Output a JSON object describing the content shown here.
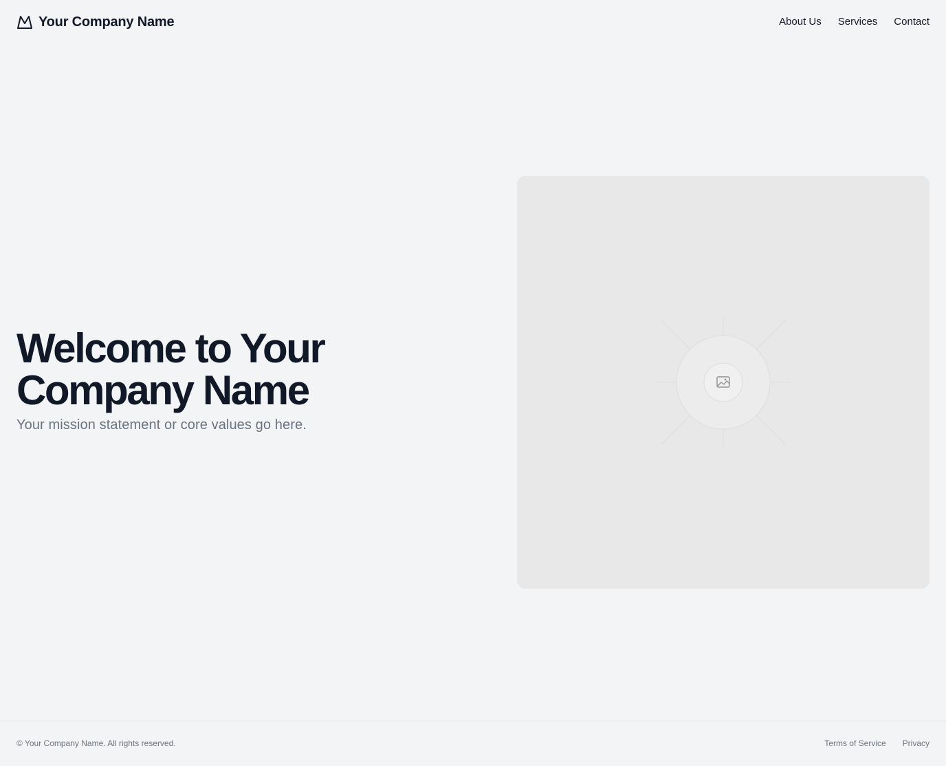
{
  "header": {
    "brand_name": "Your Company Name",
    "brand_icon": "mountain-icon",
    "nav": [
      {
        "label": "About Us"
      },
      {
        "label": "Services"
      },
      {
        "label": "Contact"
      }
    ]
  },
  "hero": {
    "title": "Welcome to Your Company Name",
    "subtitle": "Your mission statement or core values go here.",
    "image_icon": "image-placeholder-icon"
  },
  "footer": {
    "copyright": "© Your Company Name. All rights reserved.",
    "links": [
      {
        "label": "Terms of Service"
      },
      {
        "label": "Privacy"
      }
    ]
  },
  "colors": {
    "background": "#f2f4f5",
    "text_primary": "#111827",
    "text_muted": "#6b7280",
    "placeholder_bg": "#e8e8e8"
  }
}
